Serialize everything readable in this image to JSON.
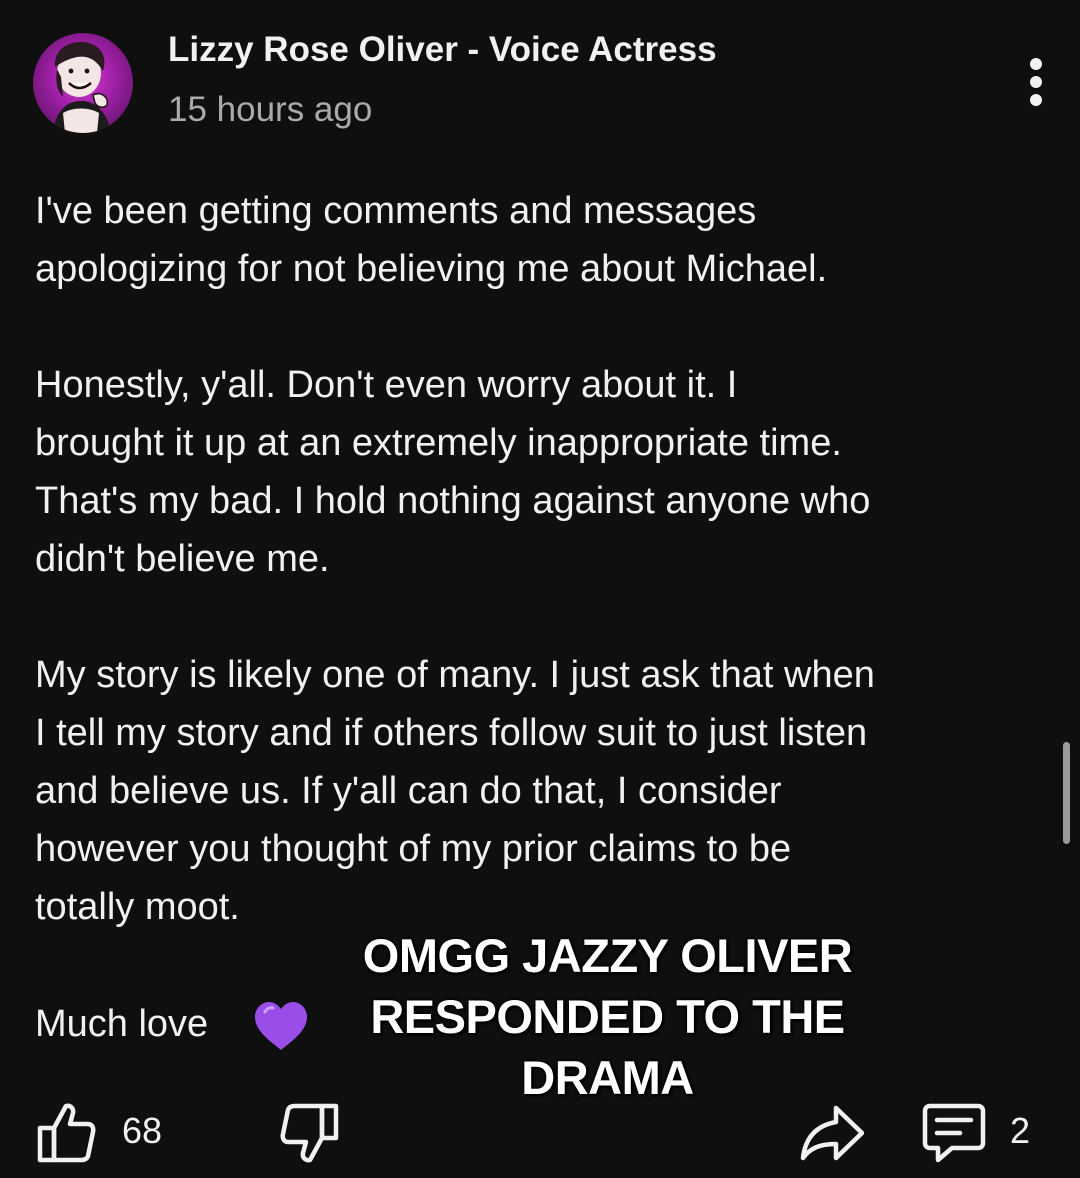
{
  "post": {
    "author": "Lizzy Rose Oliver - Voice Actress",
    "timestamp": "15 hours ago",
    "body": {
      "p1": [
        "I've been getting comments and messages",
        "apologizing for not believing me about Michael."
      ],
      "p2": [
        "Honestly, y'all. Don't even worry about it. I",
        "brought it up at an extremely inappropriate time.",
        "That's my bad. I hold nothing against anyone who",
        "didn't believe me."
      ],
      "p3": [
        "My story is likely one of many. I just ask that when",
        "I tell my story and if others follow suit to just listen",
        "and believe us. If y'all can do that, I consider",
        "however you thought of my prior claims to be",
        "totally moot."
      ],
      "closing": "Much love"
    },
    "heart_emoji_color": "#9b4de8"
  },
  "overlay_caption": [
    "OMGG JAZZY OLIVER",
    "RESPONDED TO THE",
    "DRAMA"
  ],
  "actions": {
    "like_count": "68",
    "comment_count": "2",
    "icons": {
      "like": "thumbs-up-icon",
      "dislike": "thumbs-down-icon",
      "share": "share-arrow-icon",
      "comment": "comment-icon",
      "more": "more-vertical-icon"
    }
  },
  "colors": {
    "background": "#0f0f0f",
    "text_primary": "#f1f1f1",
    "text_secondary": "#aaaaaa",
    "avatar_accent": "#c02ec4"
  }
}
